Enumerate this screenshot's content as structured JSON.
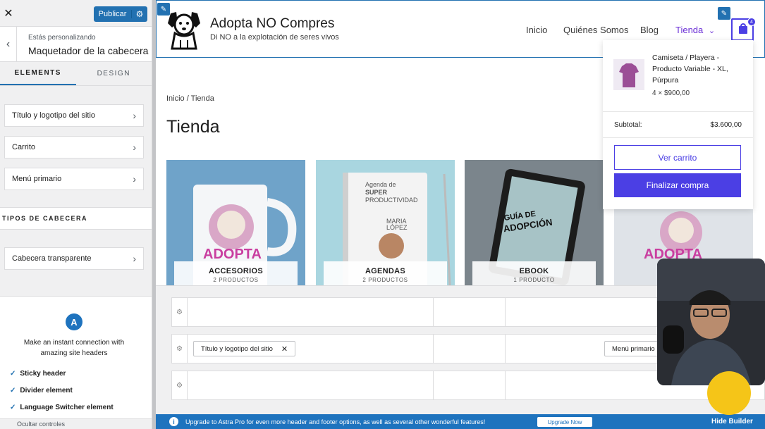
{
  "panel": {
    "publish_label": "Publicar",
    "crumb_sub": "Estás personalizando",
    "crumb_main": "Maquetador de la cabecera",
    "tabs": [
      {
        "label": "ELEMENTS"
      },
      {
        "label": "DESIGN"
      }
    ],
    "items": [
      {
        "label": "Título y logotipo del sitio"
      },
      {
        "label": "Carrito"
      },
      {
        "label": "Menú primario"
      }
    ],
    "section_title": "TIPOS DE CABECERA",
    "section_items": [
      {
        "label": "Cabecera transparente"
      }
    ],
    "promo": {
      "logo_letter": "A",
      "text": "Make an instant connection with amazing site headers",
      "features": [
        "Sticky header",
        "Divider element",
        "Language Switcher element"
      ]
    },
    "bottom_label": "Ocultar controles"
  },
  "site": {
    "title": "Adopta NO Compres",
    "tagline": "Di NO a la explotación de seres vivos",
    "nav": [
      {
        "label": "Inicio"
      },
      {
        "label": "Quiénes Somos"
      },
      {
        "label": "Blog"
      },
      {
        "label": "Tienda",
        "dropdown": "⌄"
      }
    ],
    "cart_count": "4",
    "breadcrumb": "Inicio / Tienda",
    "page_title": "Tienda",
    "categories": [
      {
        "name": "ACCESORIOS",
        "count": "2 PRODUCTOS",
        "color": "#6fa3c9"
      },
      {
        "name": "AGENDAS",
        "count": "2 PRODUCTOS",
        "color": "#a9d6e0"
      },
      {
        "name": "EBOOK",
        "count": "1 PRODUCTO",
        "color": "#7b858c"
      },
      {
        "name": "",
        "count": "",
        "color": "#dfe3e8"
      }
    ]
  },
  "mini_cart": {
    "product_name": "Camiseta / Playera - Producto Variable - XL, Púrpura",
    "qty": "4 × $900,00",
    "subtotal_label": "Subtotal:",
    "subtotal_value": "$3.600,00",
    "view_cart": "Ver carrito",
    "checkout": "Finalizar compra"
  },
  "builder": {
    "chip_title_logo": "Título y logotipo del sitio",
    "chip_menu": "Menú primario",
    "upgrade_msg": "Upgrade to Astra Pro for even more header and footer options, as well as several other wonderful features!",
    "upgrade_btn": "Upgrade Now",
    "hide_builder": "Hide Builder"
  },
  "colors": {
    "wp_blue": "#2271b1",
    "accent_purple": "#4b3fe4",
    "nav_active": "#6b2fd6"
  }
}
